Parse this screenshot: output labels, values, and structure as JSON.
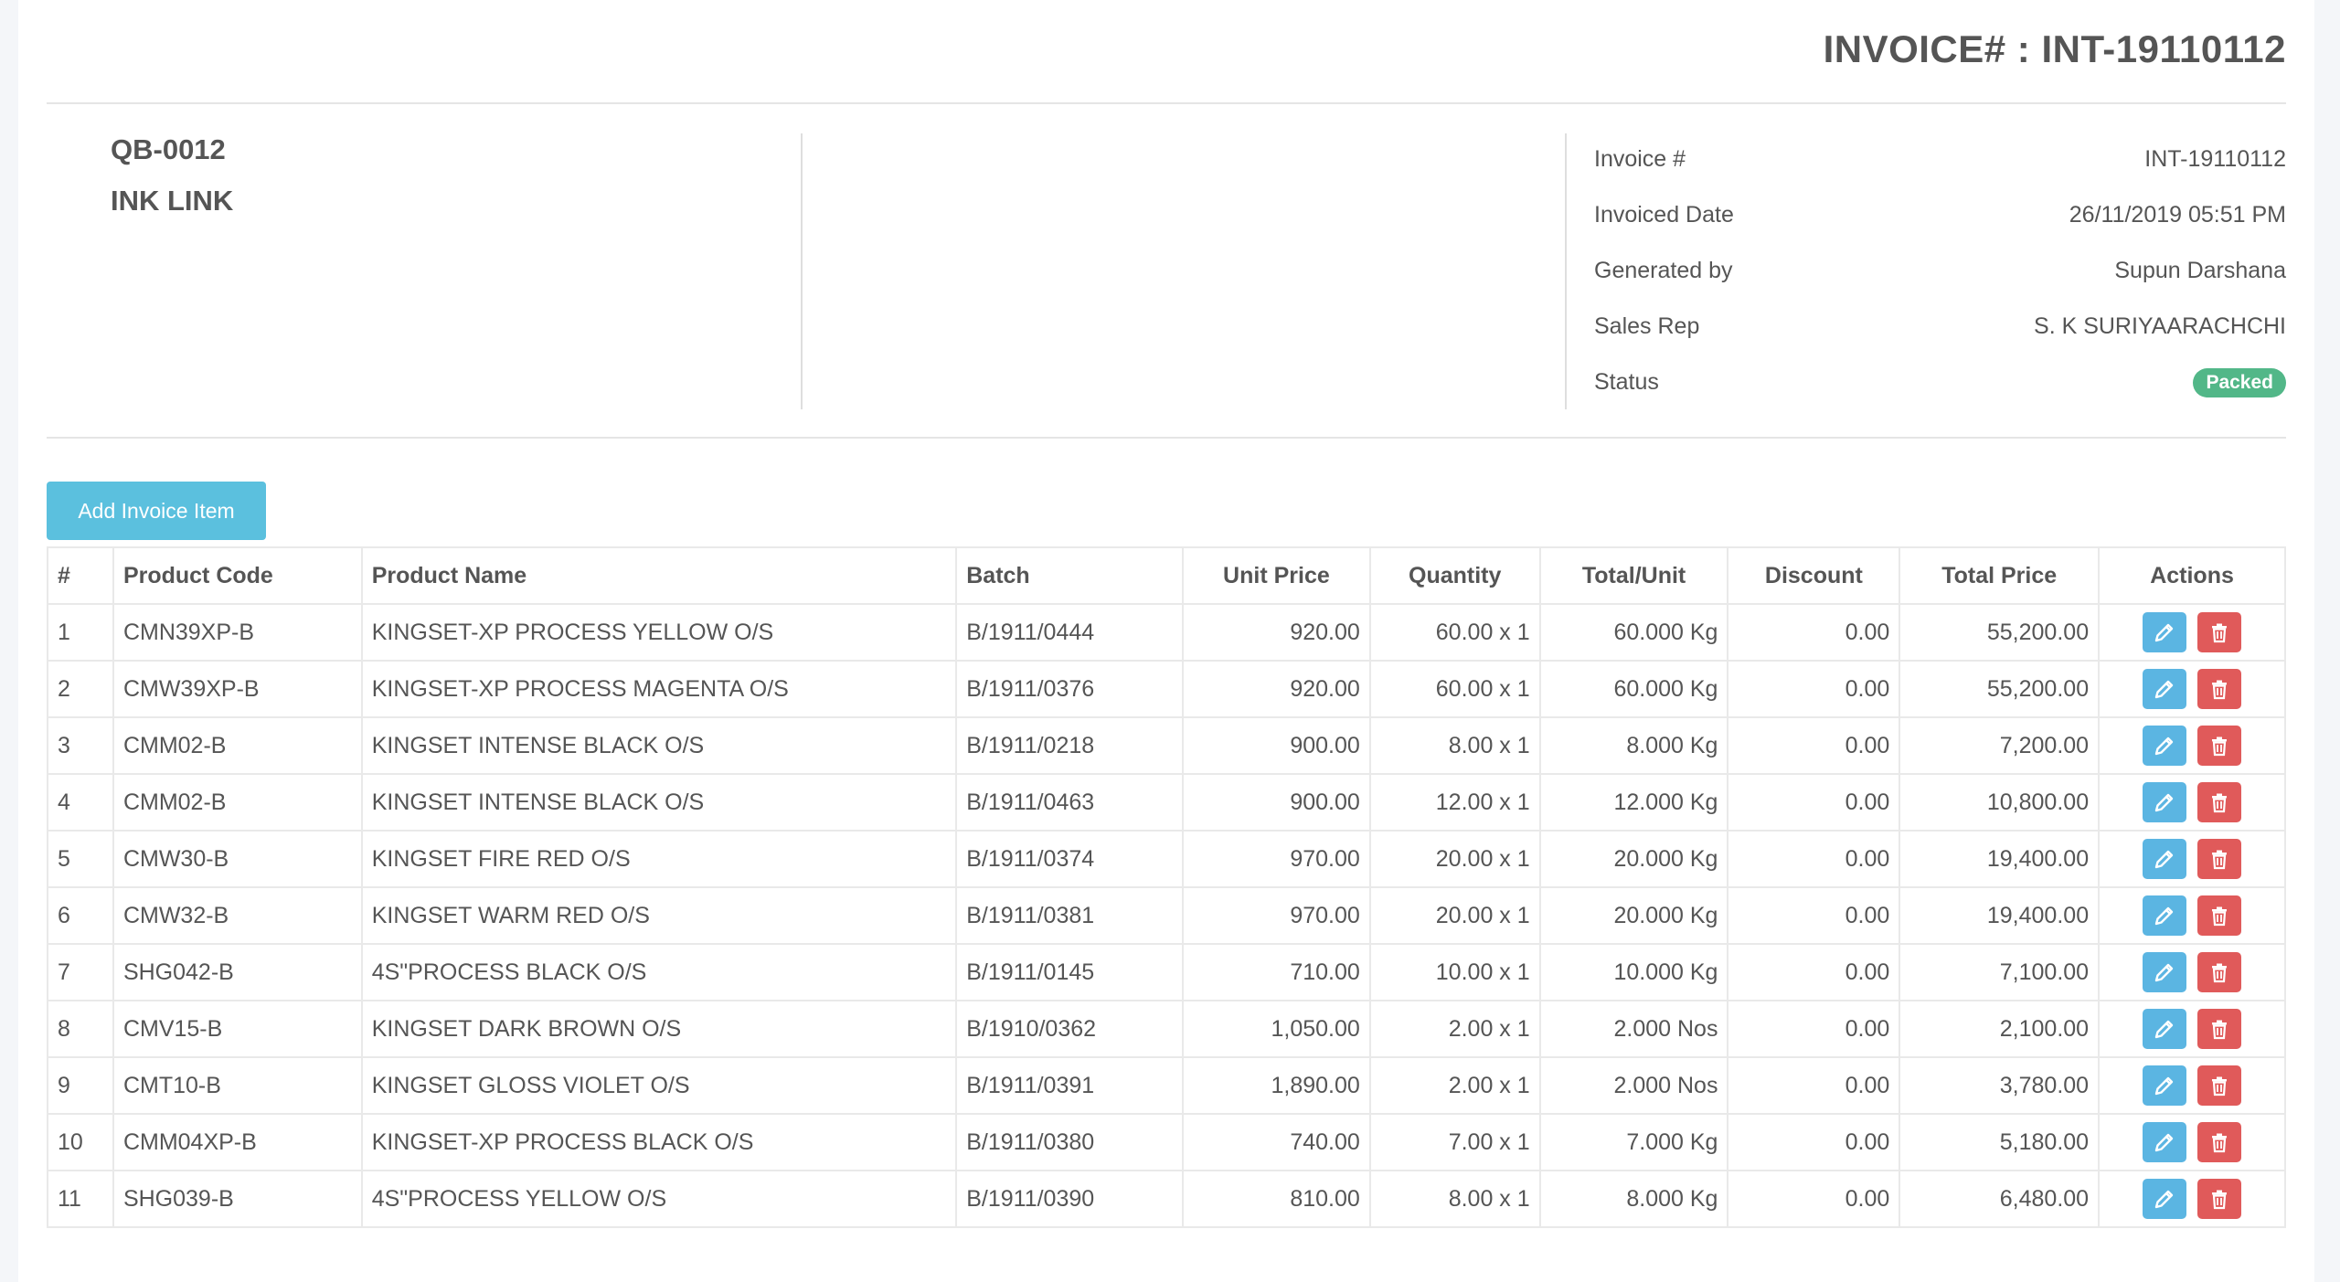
{
  "header": {
    "invoice_title": "INVOICE# : INT-19110112"
  },
  "customer": {
    "code": "QB-0012",
    "name": "INK LINK"
  },
  "meta": [
    {
      "label": "Invoice #",
      "value": "INT-19110112"
    },
    {
      "label": "Invoiced Date",
      "value": "26/11/2019 05:51 PM"
    },
    {
      "label": "Generated by",
      "value": "Supun Darshana"
    },
    {
      "label": "Sales Rep",
      "value": "S. K SURIYAARACHCHI"
    },
    {
      "label": "Status",
      "value": "Packed"
    }
  ],
  "colors": {
    "accent": "#5bc0de",
    "status_packed": "#52b788",
    "edit": "#5bb5e2",
    "delete": "#e05a5a"
  },
  "add_button_label": "Add Invoice Item",
  "table": {
    "headers": [
      "#",
      "Product Code",
      "Product Name",
      "Batch",
      "Unit Price",
      "Quantity",
      "Total/Unit",
      "Discount",
      "Total Price",
      "Actions"
    ],
    "rows": [
      [
        "1",
        "CMN39XP-B",
        "KINGSET-XP PROCESS YELLOW O/S",
        "B/1911/0444",
        "920.00",
        "60.00 x 1",
        "60.000 Kg",
        "0.00",
        "55,200.00"
      ],
      [
        "2",
        "CMW39XP-B",
        "KINGSET-XP PROCESS MAGENTA O/S",
        "B/1911/0376",
        "920.00",
        "60.00 x 1",
        "60.000 Kg",
        "0.00",
        "55,200.00"
      ],
      [
        "3",
        "CMM02-B",
        "KINGSET INTENSE BLACK O/S",
        "B/1911/0218",
        "900.00",
        "8.00 x 1",
        "8.000 Kg",
        "0.00",
        "7,200.00"
      ],
      [
        "4",
        "CMM02-B",
        "KINGSET INTENSE BLACK O/S",
        "B/1911/0463",
        "900.00",
        "12.00 x 1",
        "12.000 Kg",
        "0.00",
        "10,800.00"
      ],
      [
        "5",
        "CMW30-B",
        "KINGSET FIRE RED O/S",
        "B/1911/0374",
        "970.00",
        "20.00 x 1",
        "20.000 Kg",
        "0.00",
        "19,400.00"
      ],
      [
        "6",
        "CMW32-B",
        "KINGSET WARM RED O/S",
        "B/1911/0381",
        "970.00",
        "20.00 x 1",
        "20.000 Kg",
        "0.00",
        "19,400.00"
      ],
      [
        "7",
        "SHG042-B",
        "4S\"PROCESS BLACK O/S",
        "B/1911/0145",
        "710.00",
        "10.00 x 1",
        "10.000 Kg",
        "0.00",
        "7,100.00"
      ],
      [
        "8",
        "CMV15-B",
        "KINGSET DARK BROWN O/S",
        "B/1910/0362",
        "1,050.00",
        "2.00 x 1",
        "2.000 Nos",
        "0.00",
        "2,100.00"
      ],
      [
        "9",
        "CMT10-B",
        "KINGSET GLOSS VIOLET O/S",
        "B/1911/0391",
        "1,890.00",
        "2.00 x 1",
        "2.000 Nos",
        "0.00",
        "3,780.00"
      ],
      [
        "10",
        "CMM04XP-B",
        "KINGSET-XP PROCESS BLACK O/S",
        "B/1911/0380",
        "740.00",
        "7.00 x 1",
        "7.000 Kg",
        "0.00",
        "5,180.00"
      ],
      [
        "11",
        "SHG039-B",
        "4S\"PROCESS YELLOW O/S",
        "B/1911/0390",
        "810.00",
        "8.00 x 1",
        "8.000 Kg",
        "0.00",
        "6,480.00"
      ]
    ]
  }
}
